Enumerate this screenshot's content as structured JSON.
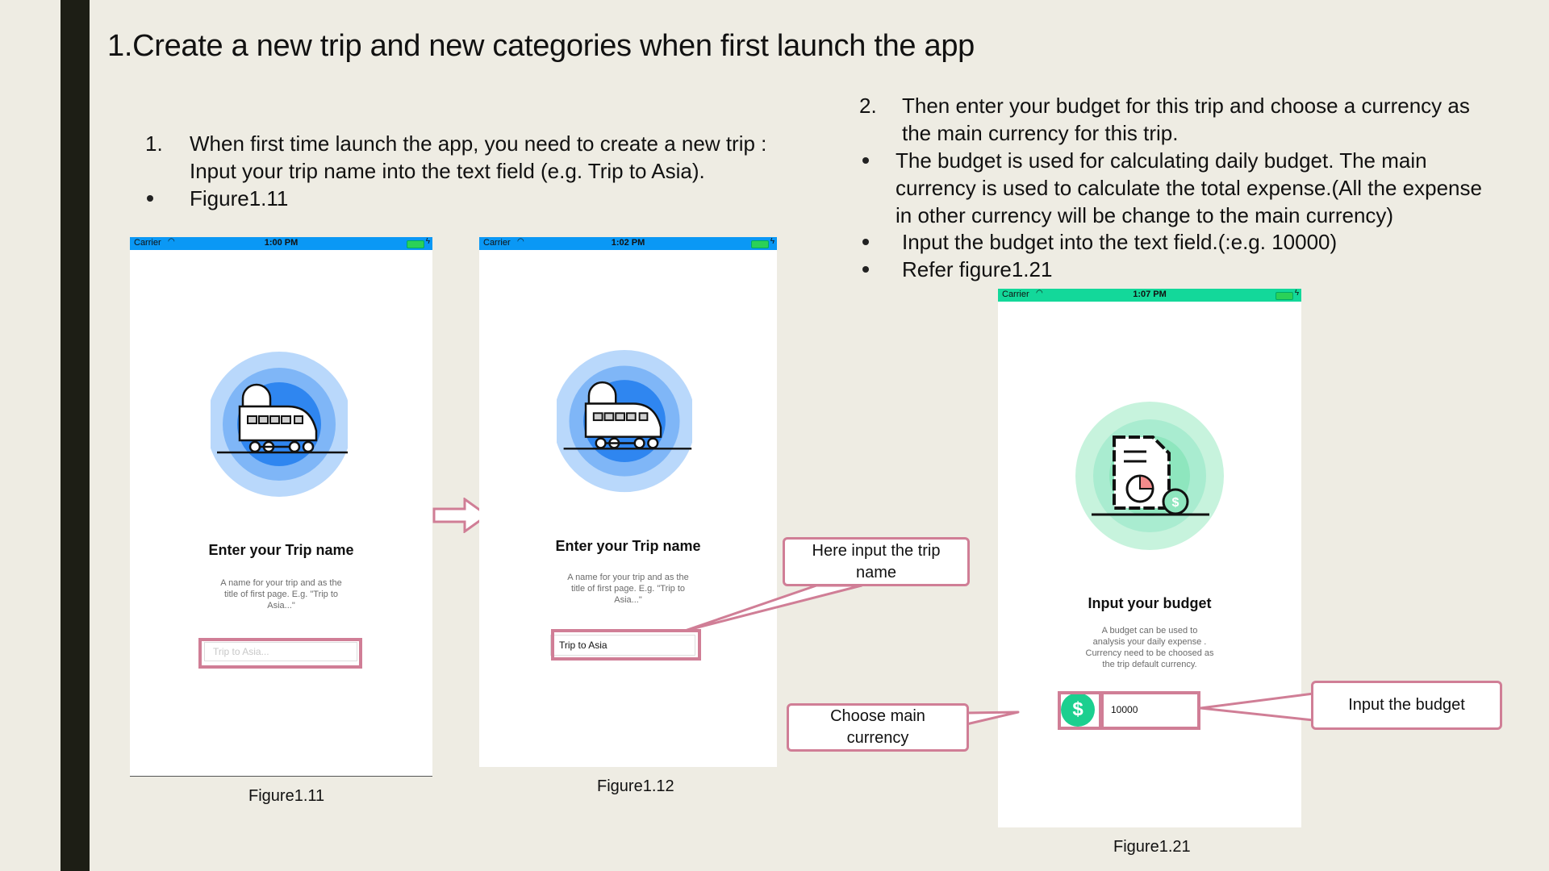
{
  "slide": {
    "title": "1.Create a new trip and new categories when first launch the app"
  },
  "left_text": {
    "marker_1": "1.",
    "item_1_line_1": "When first time launch the app, you need to create a new trip :",
    "item_1_line_2": "Input your trip name into the text field (e.g. Trip to Asia).",
    "bullet_1": "Figure1.11"
  },
  "right_text": {
    "marker_2": "2.",
    "item_2_line_1": "Then enter your budget for this trip and choose a currency as",
    "item_2_line_2": "the main currency for this trip.",
    "bullet_1_lines": [
      "The budget is used for calculating daily budget. The main",
      "currency is used  to calculate the total expense.(All the expense",
      "in other currency will be change to the main currency)"
    ],
    "bullet_2": "Input the budget into the text field.(:e.g. 10000)",
    "bullet_3": "Refer figure1.21"
  },
  "phone_1": {
    "carrier": "Carrier",
    "time": "1:00 PM",
    "status_color": "#0a98f5",
    "heading": "Enter your Trip name",
    "description": "A name for your trip and as the\ntitle of first page.  E.g. \"Trip to\nAsia...\"",
    "input_placeholder": "Trip to Asia...",
    "caption": "Figure1.11"
  },
  "phone_2": {
    "carrier": "Carrier",
    "time": "1:02 PM",
    "status_color": "#0a98f5",
    "heading": "Enter your Trip name",
    "description": "A name for your trip and as the\ntitle of first page.  E.g. \"Trip to\nAsia...\"",
    "input_value": "Trip to Asia",
    "caption": "Figure1.12"
  },
  "phone_3": {
    "carrier": "Carrier",
    "time": "1:07 PM",
    "status_color": "#13d89a",
    "heading": "Input your budget",
    "description": "A budget can be used to\nanalysis your daily expense .\nCurrency need to be choosed as\nthe trip default currency.",
    "currency_symbol": "$",
    "input_value": "10000",
    "caption": "Figure1.21"
  },
  "callouts": {
    "trip_name": [
      "Here input the trip",
      "name"
    ],
    "currency": [
      "Choose main",
      "currency"
    ],
    "budget": [
      "Input the budget"
    ]
  },
  "colors": {
    "highlight": "#d07e96",
    "train_light": "#b9d8fb",
    "train_mid": "#7fb6f7",
    "train_dark": "#2f86f0",
    "budget_light": "#c7f3dd",
    "budget_mid": "#8ee6be",
    "budget_accent": "#1ccf8f"
  }
}
